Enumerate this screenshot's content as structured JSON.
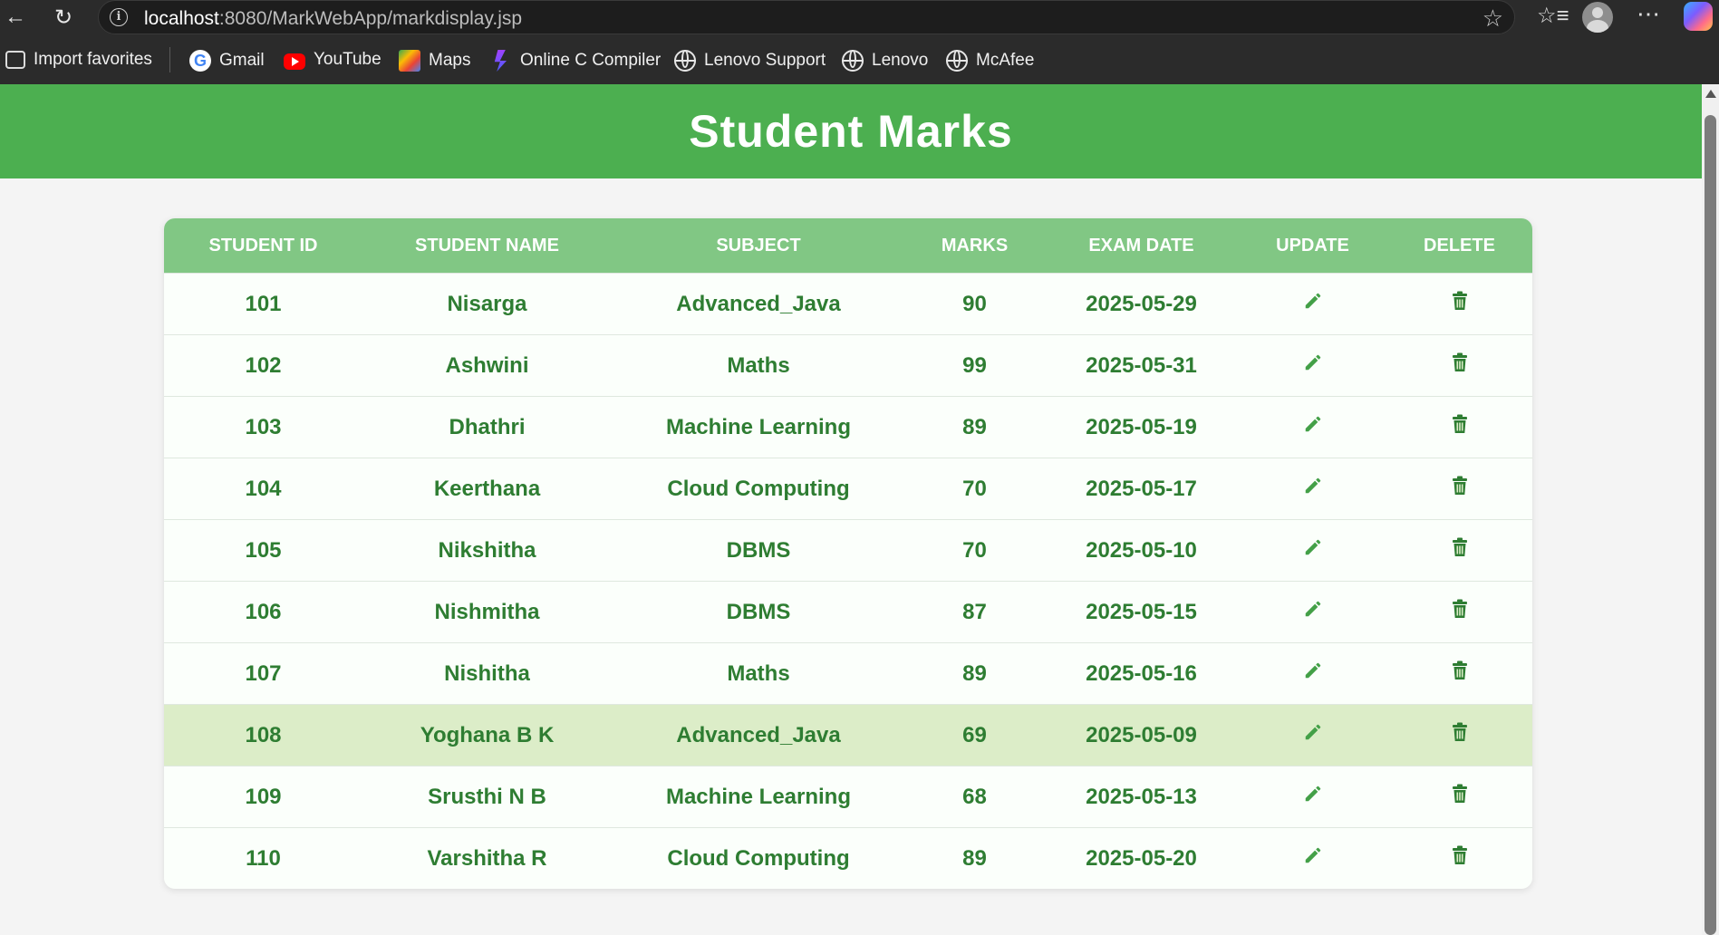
{
  "browser": {
    "url_host": "localhost",
    "url_rest": ":8080/MarkWebApp/markdisplay.jsp",
    "bookmarks": [
      {
        "label": "Import favorites",
        "icon": "import-icon"
      },
      {
        "label": "Gmail",
        "icon": "gmail-icon"
      },
      {
        "label": "YouTube",
        "icon": "youtube-icon"
      },
      {
        "label": "Maps",
        "icon": "maps-icon"
      },
      {
        "label": "Online C Compiler",
        "icon": "compiler-icon"
      },
      {
        "label": "Lenovo Support",
        "icon": "globe-icon"
      },
      {
        "label": "Lenovo",
        "icon": "globe-icon"
      },
      {
        "label": "McAfee",
        "icon": "globe-icon"
      }
    ]
  },
  "page": {
    "title": "Student Marks",
    "colors": {
      "header": "#4caf50",
      "table_head": "#81c784",
      "text": "#2e7d32",
      "highlight_row": "#dcedc8"
    }
  },
  "table": {
    "headers": [
      "Student ID",
      "Student Name",
      "Subject",
      "Marks",
      "Exam Date",
      "Update",
      "Delete"
    ],
    "rows": [
      {
        "id": "101",
        "name": "Nisarga",
        "subject": "Advanced_Java",
        "marks": "90",
        "date": "2025-05-29"
      },
      {
        "id": "102",
        "name": "Ashwini",
        "subject": "Maths",
        "marks": "99",
        "date": "2025-05-31"
      },
      {
        "id": "103",
        "name": "Dhathri",
        "subject": "Machine Learning",
        "marks": "89",
        "date": "2025-05-19"
      },
      {
        "id": "104",
        "name": "Keerthana",
        "subject": "Cloud Computing",
        "marks": "70",
        "date": "2025-05-17"
      },
      {
        "id": "105",
        "name": "Nikshitha",
        "subject": "DBMS",
        "marks": "70",
        "date": "2025-05-10"
      },
      {
        "id": "106",
        "name": "Nishmitha",
        "subject": "DBMS",
        "marks": "87",
        "date": "2025-05-15"
      },
      {
        "id": "107",
        "name": "Nishitha",
        "subject": "Maths",
        "marks": "89",
        "date": "2025-05-16"
      },
      {
        "id": "108",
        "name": "Yoghana B K",
        "subject": "Advanced_Java",
        "marks": "69",
        "date": "2025-05-09"
      },
      {
        "id": "109",
        "name": "Srusthi N B",
        "subject": "Machine Learning",
        "marks": "68",
        "date": "2025-05-13"
      },
      {
        "id": "110",
        "name": "Varshitha R",
        "subject": "Cloud Computing",
        "marks": "89",
        "date": "2025-05-20"
      }
    ],
    "highlighted_row": 7,
    "update_icon": "pencil-icon",
    "delete_icon": "trash-icon"
  }
}
